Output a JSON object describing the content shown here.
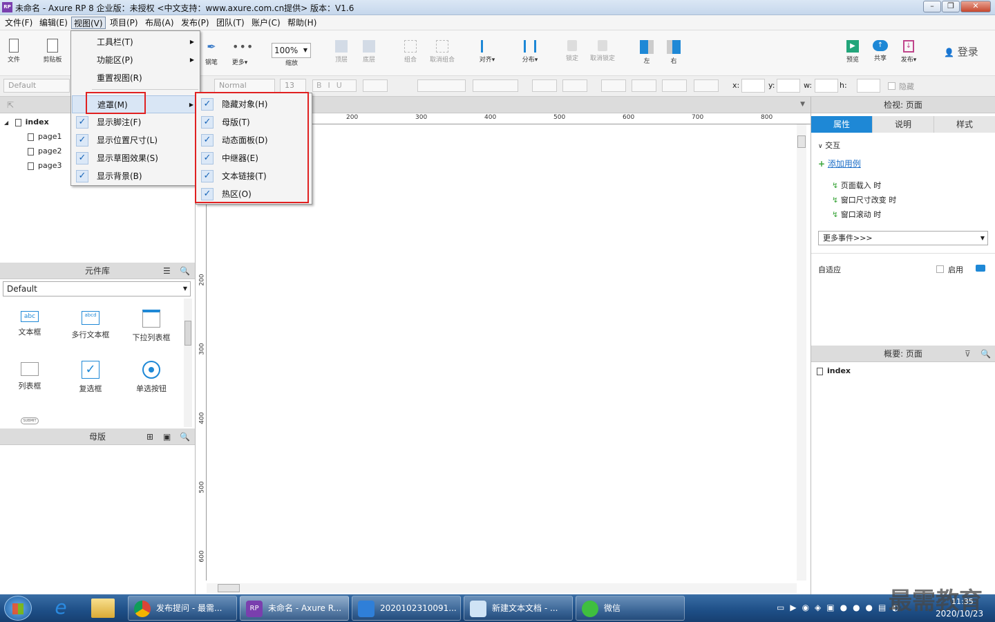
{
  "window": {
    "title": "未命名 - Axure RP 8 企业版：未授权    <中文支持：www.axure.com.cn提供> 版本：V1.6",
    "logo": "RP"
  },
  "menubar": [
    "文件(F)",
    "编辑(E)",
    "视图(V)",
    "项目(P)",
    "布局(A)",
    "发布(P)",
    "团队(T)",
    "账户(C)",
    "帮助(H)"
  ],
  "toolbar": {
    "file": "文件",
    "clipboard": "剪贴板",
    "pen": "钢笔",
    "more": "更多▾",
    "zoom_value": "100%",
    "zoom_label": "缩放",
    "top": "顶层",
    "bottom": "底层",
    "group": "组合",
    "ungroup": "取消组合",
    "align": "对齐▾",
    "distribute": "分布▾",
    "lock": "锁定",
    "unlock": "取消锁定",
    "left": "左",
    "right": "右",
    "preview": "预览",
    "share": "共享",
    "publish": "发布▾",
    "login": "登录"
  },
  "formatbar": {
    "style": "Default",
    "text_style": "Normal",
    "font_size": "13",
    "x": "x:",
    "y": "y:",
    "w": "w:",
    "h": "h:",
    "hide": "隐藏"
  },
  "pages": {
    "root": "index",
    "children": [
      "page1",
      "page2",
      "page3"
    ]
  },
  "widgets": {
    "title": "元件库",
    "library": "Default",
    "items": [
      {
        "label": "文本框",
        "icon": "abc"
      },
      {
        "label": "多行文本框",
        "icon": "abcd"
      },
      {
        "label": "下拉列表框",
        "icon": ""
      },
      {
        "label": "列表框",
        "icon": ""
      },
      {
        "label": "复选框",
        "icon": ""
      },
      {
        "label": "单选按钮",
        "icon": ""
      }
    ],
    "submit_icon": "SUBMIT"
  },
  "masters": {
    "title": "母版"
  },
  "ruler": {
    "h": [
      "200",
      "300",
      "400",
      "500",
      "600",
      "700",
      "800"
    ],
    "v": [
      "200",
      "300",
      "400",
      "500",
      "600"
    ]
  },
  "inspector": {
    "title": "检视: 页面",
    "tabs": [
      "属性",
      "说明",
      "样式"
    ],
    "interactions": "交互",
    "add_case": "添加用例",
    "events": [
      "页面载入 时",
      "窗口尺寸改变 时",
      "窗口滚动 时"
    ],
    "more_events": "更多事件>>>",
    "adaptive": "自适应",
    "enable": "启用"
  },
  "outline": {
    "title": "概要: 页面",
    "root": "index"
  },
  "view_menu": {
    "items": [
      {
        "label": "工具栏(T)",
        "submenu": true,
        "checked": false
      },
      {
        "label": "功能区(P)",
        "submenu": true,
        "checked": false
      },
      {
        "label": "重置视图(R)",
        "submenu": false,
        "checked": false
      },
      {
        "label": "遮罩(M)",
        "submenu": true,
        "checked": false
      },
      {
        "label": "显示脚注(F)",
        "submenu": false,
        "checked": true
      },
      {
        "label": "显示位置尺寸(L)",
        "submenu": false,
        "checked": true
      },
      {
        "label": "显示草图效果(S)",
        "submenu": false,
        "checked": true
      },
      {
        "label": "显示背景(B)",
        "submenu": false,
        "checked": true
      }
    ]
  },
  "mask_submenu": [
    "隐藏对象(H)",
    "母版(T)",
    "动态面板(D)",
    "中继器(E)",
    "文本链接(T)",
    "热区(O)"
  ],
  "taskbar": {
    "tasks": [
      "发布提问 - 最需...",
      "未命名 - Axure R...",
      "2020102310091...",
      "新建文本文档 - ...",
      "微信"
    ],
    "time": "11:35",
    "date": "2020/10/23",
    "watermark": "最需教育"
  },
  "colors": {
    "accent": "#1e88d6",
    "highlight": "#e02020",
    "taskbar": "#1d4e86"
  }
}
